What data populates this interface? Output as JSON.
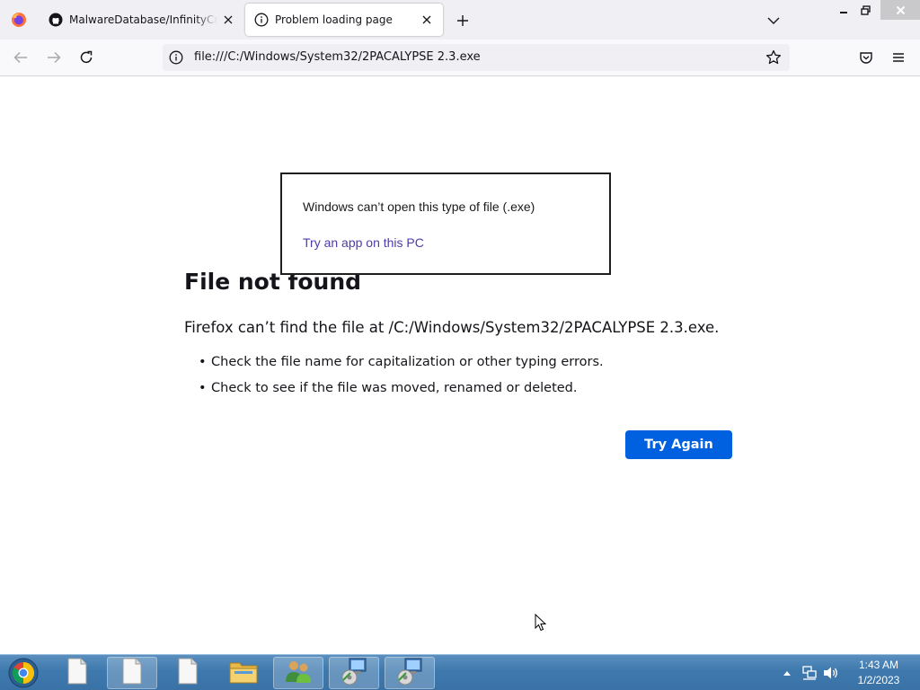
{
  "browser": {
    "tabs": [
      {
        "title": "MalwareDatabase/InfinityCrypt",
        "icon": "github-icon",
        "active": false
      },
      {
        "title": "Problem loading page",
        "icon": "info-icon",
        "active": true
      }
    ],
    "url": "file:///C:/Windows/System32/2PACALYPSE 2.3.exe"
  },
  "error_page": {
    "title": "File not found",
    "description": "Firefox can’t find the file at /C:/Windows/System32/2PACALYPSE 2.3.exe.",
    "suggestions": [
      "Check the file name for capitalization or other typing errors.",
      "Check to see if the file was moved, renamed or deleted."
    ],
    "button_label": "Try Again",
    "button_color": "#0061e0"
  },
  "popup": {
    "message": "Windows can’t open this type of file (.exe)",
    "link": "Try an app on this PC",
    "link_color": "#4f3ba8"
  },
  "taskbar": {
    "items": [
      {
        "name": "chrome-icon",
        "active": false
      },
      {
        "name": "document-icon",
        "active": false
      },
      {
        "name": "document-icon",
        "active": true
      },
      {
        "name": "document-icon",
        "active": false
      },
      {
        "name": "file-explorer-icon",
        "active": false
      },
      {
        "name": "users-icon",
        "active": true
      },
      {
        "name": "setup-program-icon",
        "active": true
      },
      {
        "name": "setup-program-icon",
        "active": true
      }
    ],
    "clock": {
      "time": "1:43 AM",
      "date": "1/2/2023"
    }
  }
}
